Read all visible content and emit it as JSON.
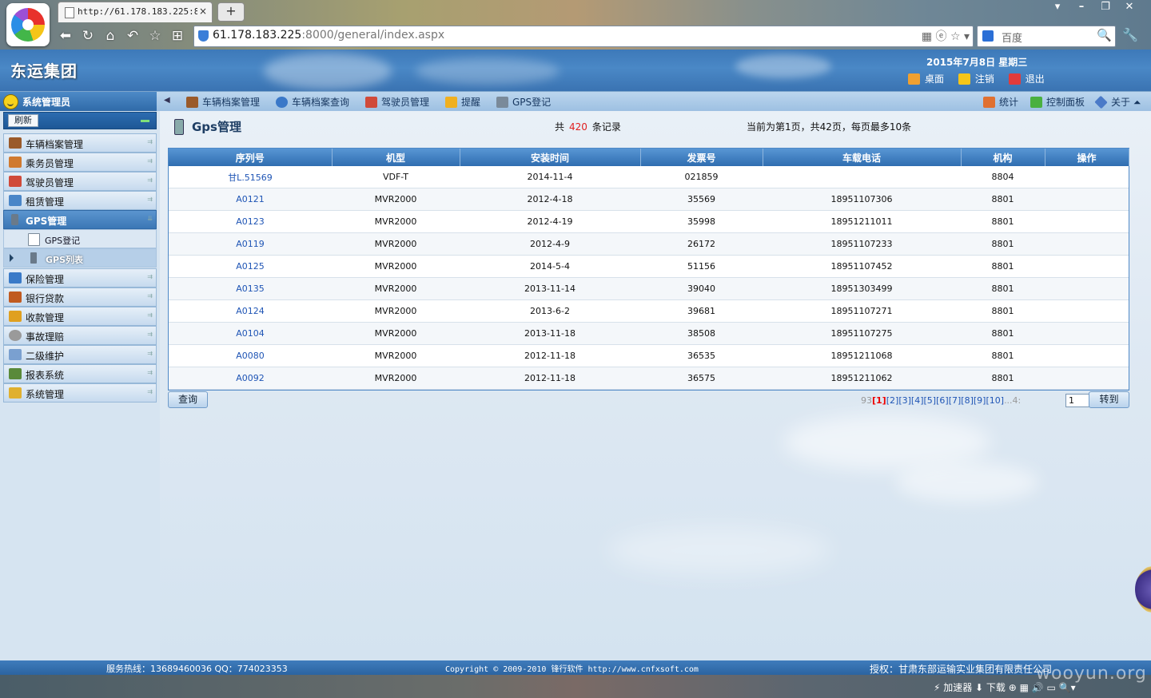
{
  "browser": {
    "tab_title": "http://61.178.183.225:800",
    "tab_close": "×",
    "new_tab": "+",
    "window_controls": [
      "▾",
      "–",
      "❐",
      "✕"
    ],
    "nav_icons": [
      "⬅",
      "↻",
      "⌂",
      "↶",
      "☆",
      "⊞"
    ],
    "url_host": "61.178.183.225",
    "url_rest": ":8000/general/index.aspx",
    "url_right_icons": "▦ ⓔ ☆ ▾",
    "search_placeholder": "百度",
    "search_icon": "🔍",
    "wrench": "🔧"
  },
  "header": {
    "app_title": "东运集团",
    "date": "2015年7月8日  星期三",
    "links": [
      {
        "label": "桌面",
        "icon": "desktop-icon",
        "color": "#f0a030"
      },
      {
        "label": "注销",
        "icon": "logout-icon",
        "color": "#f5c518"
      },
      {
        "label": "退出",
        "icon": "exit-icon",
        "color": "#e23b3b"
      }
    ]
  },
  "toolbar": {
    "user": "系统管理员",
    "arrow": "◀",
    "items": [
      {
        "label": "车辆档案管理",
        "icon": "truck-icon",
        "color": "#9a5a2a"
      },
      {
        "label": "车辆档案查询",
        "icon": "search-icon",
        "color": "#3a78c8"
      },
      {
        "label": "驾驶员管理",
        "icon": "driver-icon",
        "color": "#d04a3a"
      },
      {
        "label": "提醒",
        "icon": "star-icon",
        "color": "#f0b020"
      },
      {
        "label": "GPS登记",
        "icon": "edit-icon",
        "color": "#7a8a9a"
      }
    ],
    "right_items": [
      {
        "label": "统计",
        "icon": "stats-icon",
        "color": "#e07030"
      },
      {
        "label": "控制面板",
        "icon": "control-panel-icon",
        "color": "#4ab040"
      },
      {
        "label": "关于",
        "icon": "about-icon",
        "color": "#4a7ac8"
      }
    ],
    "right_arrow": "⏶"
  },
  "sidebar": {
    "refresh": "刷新",
    "menu": [
      {
        "label": "车辆档案管理",
        "icon": "truck-icon",
        "color": "#9a5a2a"
      },
      {
        "label": "乘务员管理",
        "icon": "staff-icon",
        "color": "#d07a30"
      },
      {
        "label": "驾驶员管理",
        "icon": "driver-icon",
        "color": "#d04a3a"
      },
      {
        "label": "租赁管理",
        "icon": "lease-icon",
        "color": "#4a86c8"
      },
      {
        "label": "GPS管理",
        "icon": "gps-icon",
        "color": "#6a7a8a"
      }
    ],
    "gps_sub": [
      {
        "label": "GPS登记",
        "icon": "edit-icon",
        "color": "#8aa0b8"
      },
      {
        "label": "GPS列表",
        "icon": "gps-list-icon",
        "color": "#6a7a8a"
      }
    ],
    "menu2": [
      {
        "label": "保险管理",
        "icon": "insurance-icon",
        "color": "#3a7ac8"
      },
      {
        "label": "银行贷款",
        "icon": "briefcase-icon",
        "color": "#c05a20"
      },
      {
        "label": "收款管理",
        "icon": "payment-icon",
        "color": "#e0a020"
      },
      {
        "label": "事故理赔",
        "icon": "accident-icon",
        "color": "#9a9a9a"
      },
      {
        "label": "二级维护",
        "icon": "maintenance-icon",
        "color": "#7aa0d0"
      },
      {
        "label": "报表系统",
        "icon": "report-icon",
        "color": "#5a8a3a"
      },
      {
        "label": "系统管理",
        "icon": "system-icon",
        "color": "#e0b030"
      }
    ],
    "arrow": "⇉"
  },
  "main": {
    "title": "Gps管理",
    "record_prefix": "共",
    "record_count": "420",
    "record_suffix": "条记录",
    "page_info": "当前为第1页，共42页，每页最多10条",
    "columns": [
      "序列号",
      "机型",
      "安装时间",
      "发票号",
      "车载电话",
      "机构",
      "操作"
    ],
    "rows": [
      [
        "甘L.51569",
        "VDF-T",
        "2014-11-4",
        "021859",
        "",
        "8804",
        ""
      ],
      [
        "A0121",
        "MVR2000",
        "2012-4-18",
        "35569",
        "18951107306",
        "8801",
        ""
      ],
      [
        "A0123",
        "MVR2000",
        "2012-4-19",
        "35998",
        "18951211011",
        "8801",
        ""
      ],
      [
        "A0119",
        "MVR2000",
        "2012-4-9",
        "26172",
        "18951107233",
        "8801",
        ""
      ],
      [
        "A0125",
        "MVR2000",
        "2014-5-4",
        "51156",
        "18951107452",
        "8801",
        ""
      ],
      [
        "A0135",
        "MVR2000",
        "2013-11-14",
        "39040",
        "18951303499",
        "8801",
        ""
      ],
      [
        "A0124",
        "MVR2000",
        "2013-6-2",
        "39681",
        "18951107271",
        "8801",
        ""
      ],
      [
        "A0104",
        "MVR2000",
        "2013-11-18",
        "38508",
        "18951107275",
        "8801",
        ""
      ],
      [
        "A0080",
        "MVR2000",
        "2012-11-18",
        "36535",
        "18951211068",
        "8801",
        ""
      ],
      [
        "A0092",
        "MVR2000",
        "2012-11-18",
        "36575",
        "18951211062",
        "8801",
        ""
      ]
    ],
    "query_button": "查询",
    "pager_prefix": "93",
    "pager_current": "[1]",
    "pager_pages": [
      "[2]",
      "[3]",
      "[4]",
      "[5]",
      "[6]",
      "[7]",
      "[8]",
      "[9]",
      "[10]"
    ],
    "pager_suffix": "...4:",
    "goto_value": "1",
    "goto_button": "转到"
  },
  "footer": {
    "hotline": "服务热线：13689460036  QQ：774023353",
    "copyright": "Copyright © 2009-2010 锋行软件 http://www.cnfxsoft.com",
    "license": "授权：甘肃东部运输实业集团有限责任公司"
  },
  "statusbar": {
    "items": "⚡ 加速器   ⬇ 下载   ⊕  ▦  🔊  ▭  🔍▾"
  },
  "watermark": "wooyun.org"
}
